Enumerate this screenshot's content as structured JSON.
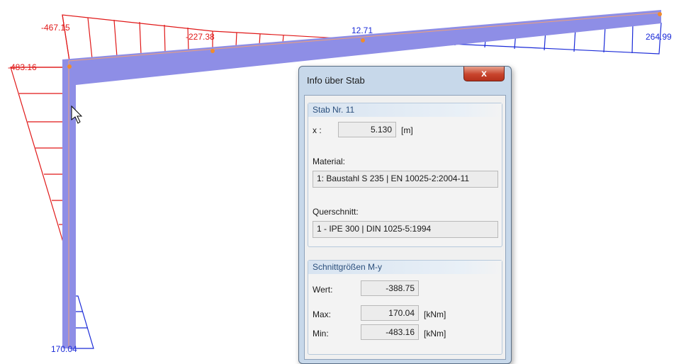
{
  "diagram": {
    "labels": {
      "left_top_moment": "-483.16",
      "beam_left_moment": "-467.15",
      "beam_mid_moment": "-227.38",
      "beam_zero_moment": "12.71",
      "beam_right_moment": "264.99",
      "column_bottom_moment": "170.04"
    },
    "colors": {
      "member": "#8e8ee6",
      "negative": "#e01818",
      "positive": "#1a2ad8"
    }
  },
  "dialog": {
    "title": "Info über Stab",
    "close_label": "x",
    "stab_group": {
      "header": "Stab Nr. 11",
      "x_label": "x :",
      "x_value": "5.130",
      "x_unit": "[m]",
      "material_label": "Material:",
      "material_value": "1: Baustahl S 235 | EN 10025-2:2004-11",
      "section_label": "Querschnitt:",
      "section_value": "1 - IPE 300 | DIN 1025-5:1994"
    },
    "forces_group": {
      "header": "Schnittgrößen M-y",
      "wert_label": "Wert:",
      "wert_value": "-388.75",
      "max_label": "Max:",
      "max_value": "170.04",
      "max_unit": "[kNm]",
      "min_label": "Min:",
      "min_value": "-483.16",
      "min_unit": "[kNm]"
    }
  }
}
